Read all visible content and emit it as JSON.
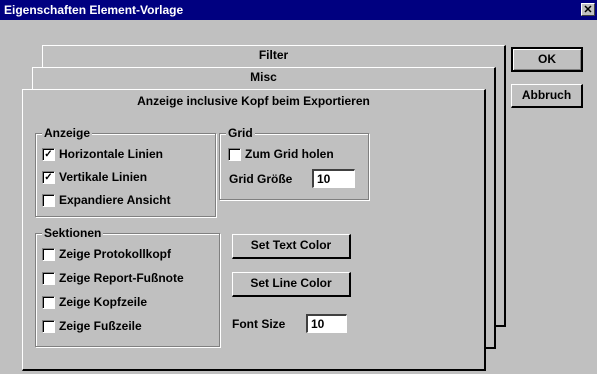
{
  "window": {
    "title": "Eigenschaften Element-Vorlage",
    "close_glyph": "✕"
  },
  "buttons": {
    "ok": "OK",
    "cancel": "Abbruch"
  },
  "tabs": {
    "filter": "Filter",
    "misc": "Misc",
    "active": "Anzeige inclusive Kopf beim Exportieren"
  },
  "anzeige": {
    "legend": "Anzeige",
    "items": [
      {
        "label": "Horizontale Linien",
        "checked": true
      },
      {
        "label": "Vertikale Linien",
        "checked": true
      },
      {
        "label": "Expandiere Ansicht",
        "checked": false
      }
    ]
  },
  "grid": {
    "legend": "Grid",
    "snap_label": "Zum Grid holen",
    "snap_checked": false,
    "size_label": "Grid Größe",
    "size_value": "10"
  },
  "sektionen": {
    "legend": "Sektionen",
    "items": [
      {
        "label": "Zeige Protokollkopf",
        "checked": false
      },
      {
        "label": "Zeige Report-Fußnote",
        "checked": false
      },
      {
        "label": "Zeige Kopfzeile",
        "checked": false
      },
      {
        "label": "Zeige Fußzeile",
        "checked": false
      }
    ]
  },
  "colors": {
    "text_button": "Set Text Color",
    "line_button": "Set Line Color"
  },
  "font": {
    "label": "Font Size",
    "value": "10"
  }
}
